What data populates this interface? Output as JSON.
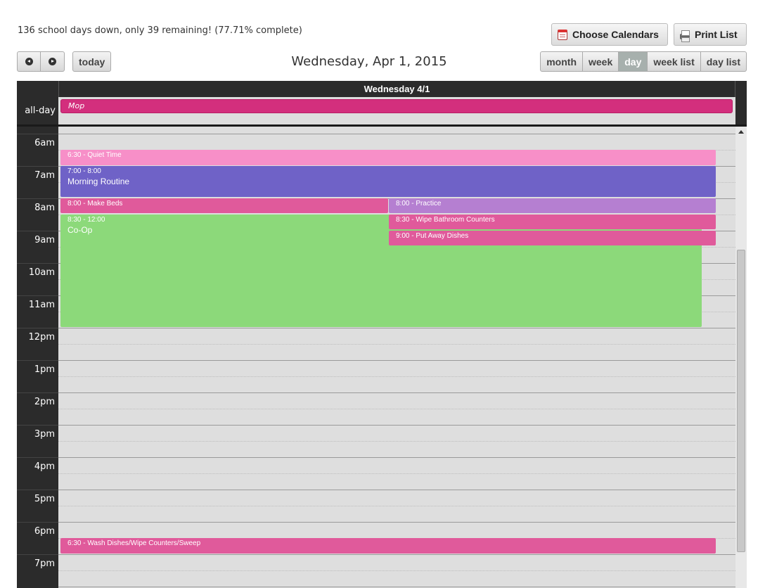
{
  "progress_text": "136 school days down, only 39 remaining! (77.71% complete)",
  "toolbar": {
    "choose_calendars": "Choose Calendars",
    "print_list": "Print List",
    "today": "today",
    "title": "Wednesday, Apr 1, 2015",
    "views": [
      "month",
      "week",
      "day",
      "week list",
      "day list"
    ],
    "active_view": "day"
  },
  "calendar": {
    "day_header": "Wednesday 4/1",
    "allday_label": "all-day",
    "allday_event": "Mop",
    "time_labels": [
      "6am",
      "7am",
      "8am",
      "9am",
      "10am",
      "11am",
      "12pm",
      "1pm",
      "2pm",
      "3pm",
      "4pm",
      "5pm",
      "6pm",
      "7pm"
    ],
    "events": [
      {
        "time": "6:30 - Quiet Time",
        "title": "",
        "color": "#f78fc8"
      },
      {
        "time": "7:00 - 8:00",
        "title": "Morning Routine",
        "color": "#6f62c7"
      },
      {
        "time": "8:00 - Make Beds",
        "title": "",
        "color": "#e05a9b"
      },
      {
        "time": "8:00 - Practice",
        "title": "",
        "color": "#b57fd1"
      },
      {
        "time": "8:30 - 12:00",
        "title": "Co-Op",
        "color": "#8cd97a"
      },
      {
        "time": "8:30 - Wipe Bathroom Counters",
        "title": "",
        "color": "#e05a9b"
      },
      {
        "time": "9:00 - Put Away Dishes",
        "title": "",
        "color": "#e05a9b"
      },
      {
        "time": "6:30 - Wash Dishes/Wipe Counters/Sweep",
        "title": "",
        "color": "#e05a9b"
      }
    ]
  }
}
